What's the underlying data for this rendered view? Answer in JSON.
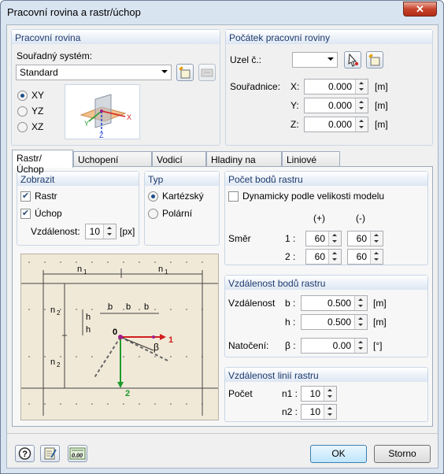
{
  "window": {
    "title": "Pracovní rovina a rastr/úchop",
    "close_label": "✕"
  },
  "work_plane": {
    "header": "Pracovní rovina",
    "coord_label": "Souřadný systém:",
    "coord_value": "Standard",
    "planes": [
      {
        "label": "XY",
        "selected": true
      },
      {
        "label": "YZ",
        "selected": false
      },
      {
        "label": "XZ",
        "selected": false
      }
    ],
    "axes": {
      "x": "X",
      "y": "Y",
      "z": "Z"
    }
  },
  "origin": {
    "header": "Počátek pracovní roviny",
    "node_label": "Uzel č.:",
    "node_value": "",
    "coords_label": "Souřadnice:",
    "x_label": "X:",
    "x_value": "0.000",
    "x_unit": "[m]",
    "y_label": "Y:",
    "y_value": "0.000",
    "y_unit": "[m]",
    "z_label": "Z:",
    "z_value": "0.000",
    "z_unit": "[m]"
  },
  "tabs": [
    "Rastr/Úchop",
    "Uchopení objektu",
    "Vodicí linie",
    "Hladiny na pozadí",
    "Liniové rastry"
  ],
  "display": {
    "header": "Zobrazit",
    "grid_label": "Rastr",
    "grid_checked": true,
    "snap_label": "Úchop",
    "snap_checked": true,
    "distance_label": "Vzdálenost:",
    "distance_value": "10",
    "distance_unit": "[px]"
  },
  "type": {
    "header": "Typ",
    "options": [
      {
        "label": "Kartézský",
        "selected": true
      },
      {
        "label": "Polární",
        "selected": false
      }
    ]
  },
  "grid_points": {
    "header": "Počet bodů rastru",
    "dynamic_label": "Dynamicky podle velikosti modelu",
    "dynamic_checked": false,
    "col_plus": "(+)",
    "col_minus": "(-)",
    "direction_label": "Směr",
    "row1_label": "1 :",
    "row1_plus": "60",
    "row1_minus": "60",
    "row2_label": "2 :",
    "row2_plus": "60",
    "row2_minus": "60"
  },
  "grid_distance": {
    "header": "Vzdálenost bodů rastru",
    "distance_label": "Vzdálenost",
    "b_label": "b :",
    "b_value": "0.500",
    "b_unit": "[m]",
    "h_label": "h :",
    "h_value": "0.500",
    "h_unit": "[m]",
    "rotation_label": "Natočení:",
    "beta_label": "β :",
    "beta_value": "0.00",
    "beta_unit": "[°]"
  },
  "line_distance": {
    "header": "Vzdálenost linií rastru",
    "count_label": "Počet",
    "n1_label": "n1 :",
    "n1_value": "10",
    "n2_label": "n2 :",
    "n2_value": "10"
  },
  "diagram": {
    "n1": "n",
    "n_sub1": "1",
    "n2": "n",
    "n_sub2": "2",
    "b": "b",
    "h": "h",
    "origin": "0",
    "beta": "β",
    "axis1": "1",
    "axis2": "2"
  },
  "footer": {
    "ok_label": "OK",
    "cancel_label": "Storno"
  },
  "colors": {
    "accent_red": "#d2201e",
    "accent_green": "#1f9a2c",
    "diagram_bg": "#f1e9d8"
  }
}
